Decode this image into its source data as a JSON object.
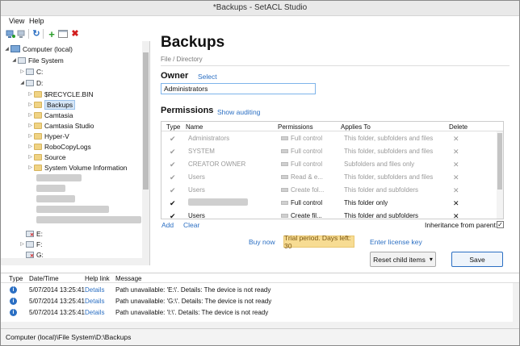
{
  "window": {
    "title": "*Backups - SetACL Studio"
  },
  "menu": {
    "view": "View",
    "help": "Help"
  },
  "toolbar": {
    "icons": [
      "add-computer-icon",
      "remove-computer-icon",
      "refresh-icon",
      "add-icon",
      "properties-icon",
      "delete-icon"
    ],
    "colors": {
      "add": "#2a9d2a",
      "delete": "#d21e1e",
      "refresh": "#2b6fc3"
    }
  },
  "tree": {
    "computer": "Computer (local)",
    "file_system": "File System",
    "drive_c": "C:",
    "drive_d": "D:",
    "folders": [
      "$RECYCLE.BIN",
      "Backups",
      "Camtasia",
      "Camtasia Studio",
      "Hyper-V",
      "RoboCopyLogs",
      "Source",
      "System Volume Information"
    ],
    "drive_e": "E:",
    "drive_f": "F:",
    "drive_g": "G:"
  },
  "main": {
    "title": "Backups",
    "subtitle": "File / Directory",
    "owner_label": "Owner",
    "owner_select": "Select",
    "owner_value": "Administrators",
    "permissions_label": "Permissions",
    "show_auditing": "Show auditing",
    "columns": [
      "Type",
      "Name",
      "Permissions",
      "Applies To",
      "Delete"
    ],
    "rows": [
      {
        "type": "✔",
        "name": "Administrators",
        "permissions": "Full control",
        "applies_to": "This folder, subfolders and files",
        "delete": "✕"
      },
      {
        "type": "✔",
        "name": "SYSTEM",
        "permissions": "Full control",
        "applies_to": "This folder, subfolders and files",
        "delete": "✕"
      },
      {
        "type": "✔",
        "name": "CREATOR OWNER",
        "permissions": "Full control",
        "applies_to": "Subfolders and files only",
        "delete": "✕"
      },
      {
        "type": "✔",
        "name": "Users",
        "permissions": "Read & e...",
        "applies_to": "This folder, subfolders and files",
        "delete": "✕"
      },
      {
        "type": "✔",
        "name": "Users",
        "permissions": "Create fol...",
        "applies_to": "This folder and subfolders",
        "delete": "✕"
      },
      {
        "type": "✔",
        "name": "",
        "permissions": "Full control",
        "applies_to": "This folder only",
        "delete": "✕"
      },
      {
        "type": "✔",
        "name": "Users",
        "permissions": "Create fil...",
        "applies_to": "This folder and subfolders",
        "delete": "✕"
      }
    ],
    "add_link": "Add",
    "clear_link": "Clear",
    "inheritance_label": "Inheritance from parent:",
    "inheritance_checked": "✓",
    "buy_now": "Buy now",
    "trial": "Trial period. Days left: 30",
    "license": "Enter license key",
    "reset_button": "Reset child items",
    "reset_caret": "▾",
    "save_button": "Save"
  },
  "log": {
    "columns": [
      "Type",
      "Date/Time",
      "Help link",
      "Message"
    ],
    "rows": [
      {
        "type": "i",
        "datetime": "5/07/2014 13:25:41",
        "help": "Details",
        "message": "Path unavailable: 'E:\\'. Details: The device is not ready"
      },
      {
        "type": "i",
        "datetime": "5/07/2014 13:25:41",
        "help": "Details",
        "message": "Path unavailable: 'G:\\'. Details: The device is not ready"
      },
      {
        "type": "i",
        "datetime": "5/07/2014 13:25:41",
        "help": "Details",
        "message": "Path unavailable: 'I:\\'. Details: The device is not ready"
      }
    ]
  },
  "statusbar": {
    "text": "Computer (local)\\File System\\D:\\Backups"
  }
}
